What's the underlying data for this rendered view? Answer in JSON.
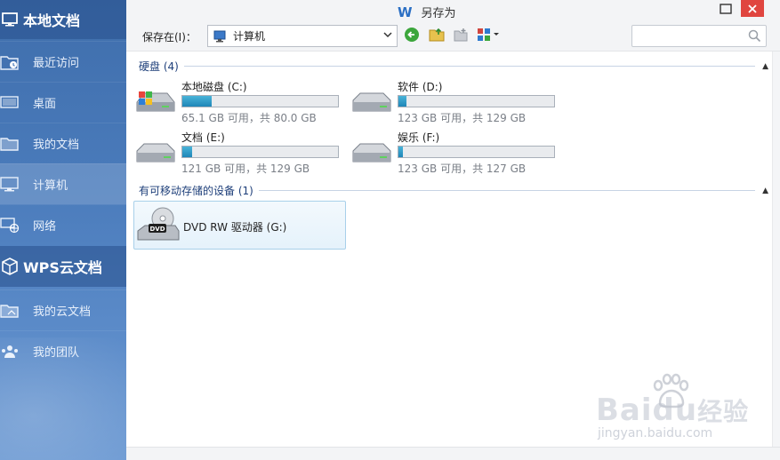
{
  "sidebar": {
    "local_header": "本地文档",
    "local_items": [
      {
        "label": "最近访问",
        "icon": "recent-folder-icon"
      },
      {
        "label": "桌面",
        "icon": "desktop-icon"
      },
      {
        "label": "我的文档",
        "icon": "folder-icon"
      },
      {
        "label": "计算机",
        "icon": "computer-icon"
      },
      {
        "label": "网络",
        "icon": "network-icon"
      }
    ],
    "cloud_header": "WPS云文档",
    "cloud_items": [
      {
        "label": "我的云文档",
        "icon": "cloud-folder-icon"
      },
      {
        "label": "我的团队",
        "icon": "team-icon"
      }
    ]
  },
  "dialog": {
    "title": "另存为",
    "brand_letter": "W",
    "save_in_label": "保存在(I)：",
    "location": "计算机",
    "search_placeholder": ""
  },
  "groups": {
    "hard_disks": {
      "title": "硬盘 (4)",
      "drives": [
        {
          "name": "本地磁盘 (C:)",
          "capacity": "65.1 GB 可用，共 80.0 GB",
          "used_fraction": 0.19
        },
        {
          "name": "软件 (D:)",
          "capacity": "123 GB 可用，共 129 GB",
          "used_fraction": 0.05
        },
        {
          "name": "文档 (E:)",
          "capacity": "121 GB 可用，共 129 GB",
          "used_fraction": 0.06
        },
        {
          "name": "娱乐 (F:)",
          "capacity": "123 GB 可用，共 127 GB",
          "used_fraction": 0.03
        }
      ]
    },
    "removable": {
      "title": "有可移动存储的设备 (1)",
      "devices": [
        {
          "name": "DVD RW 驱动器 (G:)",
          "badge": "DVD"
        }
      ]
    }
  },
  "watermark": {
    "brand": "Bai",
    "brand2": "du",
    "brand_cn": "经验",
    "url": "jingyan.baidu.com"
  },
  "colors": {
    "sidebar": "#4a7bbb",
    "close": "#e0453f",
    "bar_fill": "#1f86b8",
    "selection_border": "#a8d0ea"
  }
}
